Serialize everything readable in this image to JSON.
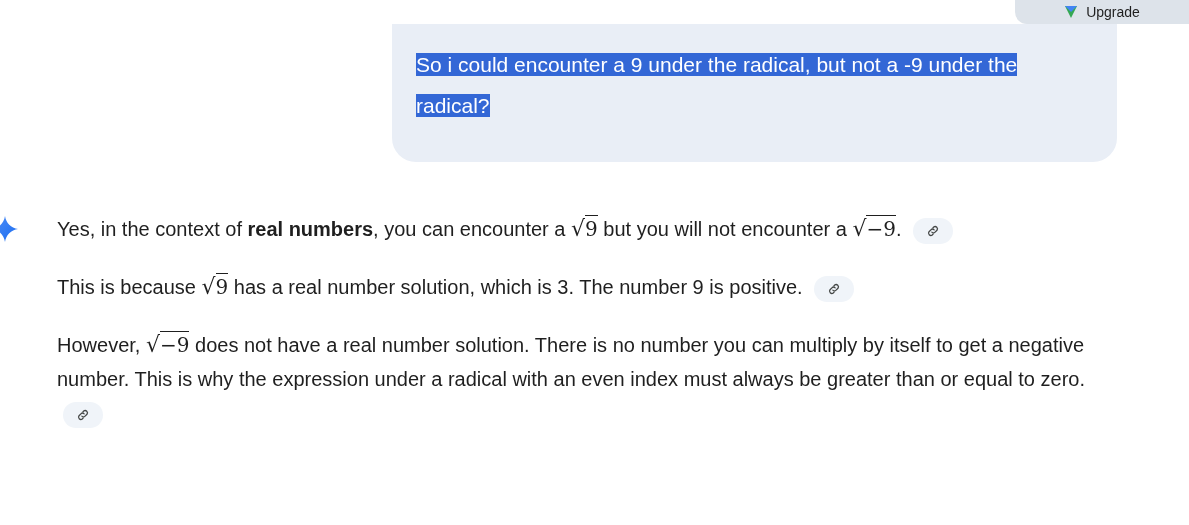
{
  "upgrade_button": {
    "label": "Upgrade"
  },
  "user_message": {
    "text": "So i could encounter a 9 under the radical, but not a -9 under the radical?",
    "selected": true
  },
  "response": {
    "paragraphs": [
      {
        "segments": [
          {
            "kind": "text",
            "text": "Yes, in the context of **real numbers**, you can encounter a "
          },
          {
            "kind": "sqrt",
            "sign": "√",
            "radicand": "9"
          },
          {
            "kind": "text",
            "text": " but you will not encounter a "
          },
          {
            "kind": "sqrt",
            "sign": "√",
            "radicand": "−9"
          },
          {
            "kind": "text",
            "text": "."
          }
        ]
      },
      {
        "segments": [
          {
            "kind": "text",
            "text": "This is because "
          },
          {
            "kind": "sqrt",
            "sign": "√",
            "radicand": "9"
          },
          {
            "kind": "text",
            "text": " has a real number solution, which is 3. The number 9 is positive."
          }
        ]
      },
      {
        "segments": [
          {
            "kind": "text",
            "text": "However, "
          },
          {
            "kind": "sqrt",
            "sign": "√",
            "radicand": "−9"
          },
          {
            "kind": "text",
            "text": " does not have a real number solution. There is no number you can multiply by itself to get a negative number. This is why the expression under a radical with an even index must always be greater than or equal to zero."
          }
        ]
      }
    ]
  }
}
